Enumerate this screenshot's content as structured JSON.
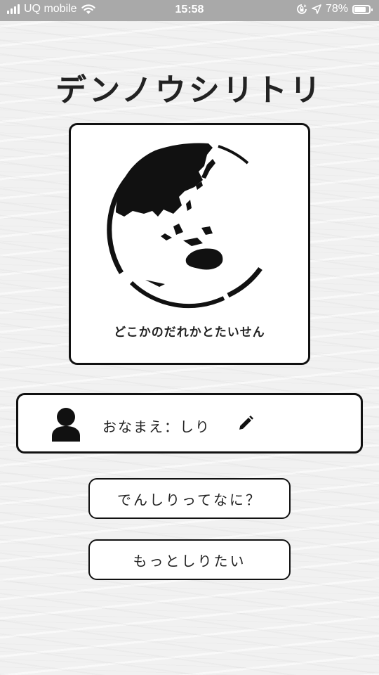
{
  "status_bar": {
    "carrier": "UQ mobile",
    "time": "15:58",
    "battery": "78%",
    "battery_level": 0.78,
    "icons": [
      "signal-icon",
      "wifi-icon",
      "orientation-lock-icon",
      "location-icon",
      "battery-icon"
    ]
  },
  "app": {
    "title": "デンノウシリトリ"
  },
  "world_card": {
    "label": "どこかのだれかとたいせん",
    "icon": "globe-icon"
  },
  "profile": {
    "name_label": "おなまえ：しり",
    "icons": [
      "user-icon",
      "pencil-icon"
    ]
  },
  "buttons": {
    "what_is": "でんしりってなに？",
    "learn_more": "もっとしりたい"
  },
  "colors": {
    "status_bar": "#a9a9a9",
    "border": "#111111",
    "card": "#ffffff"
  }
}
